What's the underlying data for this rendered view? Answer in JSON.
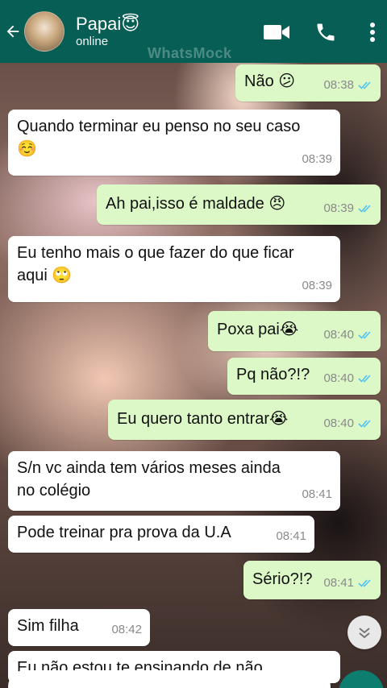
{
  "header": {
    "back_icon": "arrow-left-icon",
    "contact_name": "Papai😇",
    "status": "online",
    "watermark": "WhatsMock",
    "icons": [
      "video-call-icon",
      "phone-icon",
      "more-vert-icon"
    ],
    "color": "#075e55"
  },
  "messages": [
    {
      "dir": "out",
      "text": "Não 😕",
      "time": "08:38"
    },
    {
      "dir": "in",
      "text": "Quando terminar eu penso no seu caso",
      "text2": "☺️",
      "time": "08:39"
    },
    {
      "dir": "out",
      "text": "Ah pai,isso é maldade 😠",
      "time": "08:39"
    },
    {
      "dir": "in",
      "text": "Eu tenho mais o que fazer do que ficar",
      "text2": "aqui 🙄",
      "time": "08:39"
    },
    {
      "dir": "out",
      "text": "Poxa pai😭",
      "time": "08:40"
    },
    {
      "dir": "out",
      "text": "Pq não?!?",
      "time": "08:40"
    },
    {
      "dir": "out",
      "text": "Eu quero tanto entrar😭",
      "time": "08:40"
    },
    {
      "dir": "in",
      "text": "S/n vc ainda tem vários meses ainda",
      "text2": "no colégio",
      "time": "08:41"
    },
    {
      "dir": "in",
      "text": "Pode treinar pra prova da U.A",
      "time": "08:41"
    },
    {
      "dir": "out",
      "text": "Sério?!?",
      "time": "08:41"
    },
    {
      "dir": "in",
      "text": "Sim filha",
      "time": "08:42"
    },
    {
      "dir": "in",
      "text": "Eu não estou te ensinando de não",
      "time": ""
    }
  ],
  "colors": {
    "incoming": "#ffffff",
    "outgoing": "#dcf8c6",
    "read_ticks": "#4fc3f7"
  },
  "scroll_down_icon": "double-chevron-down-icon"
}
